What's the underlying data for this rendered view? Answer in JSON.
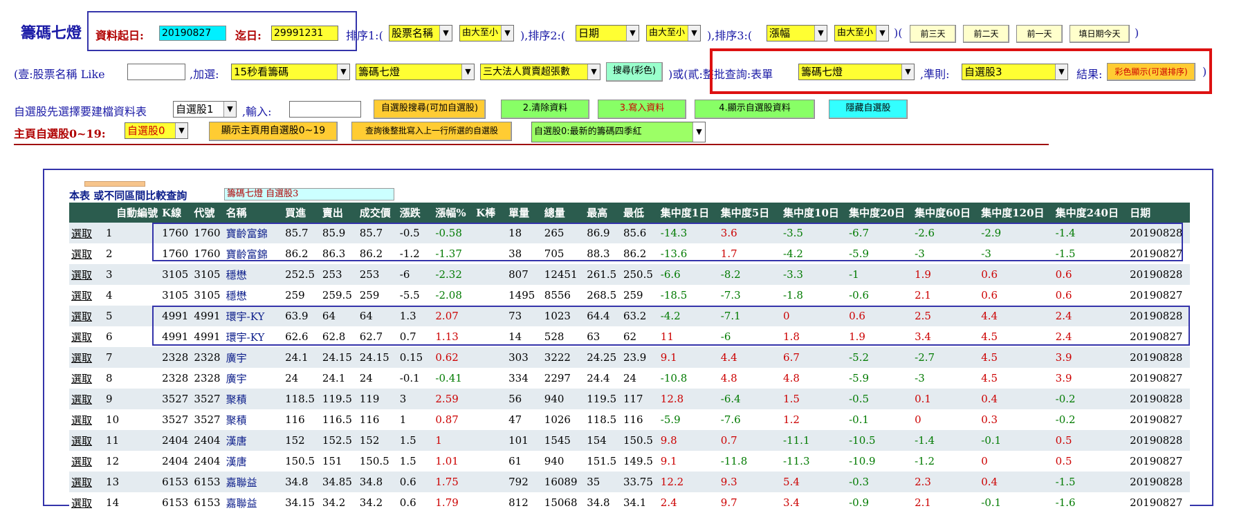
{
  "header": {
    "title": "籌碼七燈",
    "start_label": "資料起日:",
    "start_value": "20190827",
    "end_label": "迄日:",
    "end_value": "29991231",
    "sort1_label": "排序1:(",
    "sort1_field": "股票名稱",
    "sort1_order": "由大至小",
    "sort2_label": "),排序2:(",
    "sort2_field": "日期",
    "sort2_order": "由大至小",
    "sort3_label": "),排序3:(",
    "sort3_field": "漲幅",
    "sort3_order": "由大至小",
    "sort3_close": ")(",
    "btn_3days": "前三天",
    "btn_2days": "前二天",
    "btn_1day": "前一天",
    "btn_today": "填日期今天",
    "paren_close": ")"
  },
  "row2": {
    "like_label": "(壹:股票名稱 Like",
    "like_value": "",
    "add_label": ",加選:",
    "add1": "15秒看籌碼",
    "add2": "籌碼七燈",
    "add3": "三大法人買賣超張數",
    "search_btn": "搜尋(彩色)",
    "or_label": ")或(貳:整批查詢:表單",
    "form_select": "籌碼七燈",
    "rule_label": ",準則:",
    "rule_select": "自選股3",
    "result_label": "結果:",
    "result_btn": "彩色顯示(可選排序)",
    "close": ")"
  },
  "row3": {
    "label": "自選股先選擇要建檔資料表",
    "table_select": "自選股1",
    "input_label": ",輸入:",
    "input_value": "",
    "btn_search": "自選股搜尋(可加自選股)",
    "btn_clear": "2.清除資料",
    "btn_write": "3.寫入資料",
    "btn_show": "4.顯示自選股資料",
    "btn_hide": "隱藏自選股"
  },
  "row4": {
    "label": "主頁自選股0~19:",
    "select": "自選股0",
    "btn_show": "顯示主頁用自選股0~19",
    "btn_batch": "查詢後整批寫入上一行所選的自選股",
    "info_select": "自選股0:最新的籌碼四季紅"
  },
  "table_section": {
    "caption": "本表 或不同區間比較查詢",
    "caption_box": "籌碼七燈 自選股3",
    "pick_label": "選取",
    "columns": [
      "自動編號",
      "K線",
      "代號",
      "名稱",
      "買進",
      "賣出",
      "成交價",
      "漲跌",
      "漲幅%",
      "K棒",
      "單量",
      "總量",
      "最高",
      "最低",
      "集中度1日",
      "集中度5日",
      "集中度10日",
      "集中度20日",
      "集中度60日",
      "集中度120日",
      "集中度240日",
      "日期"
    ],
    "rows": [
      [
        "1",
        "1760",
        "1760",
        "寶齡富錦",
        "85.7",
        "85.9",
        "85.7",
        "-0.5",
        "-0.58",
        "",
        "18",
        "265",
        "86.9",
        "85.6",
        "-14.3",
        "3.6",
        "-3.5",
        "-6.7",
        "-2.6",
        "-2.9",
        "-1.4",
        "20190828"
      ],
      [
        "2",
        "1760",
        "1760",
        "寶齡富錦",
        "86.2",
        "86.3",
        "86.2",
        "-1.2",
        "-1.37",
        "",
        "38",
        "705",
        "88.3",
        "86.2",
        "-13.6",
        "1.7",
        "-4.2",
        "-5.9",
        "-3",
        "-3",
        "-1.5",
        "20190827"
      ],
      [
        "3",
        "3105",
        "3105",
        "穩懋",
        "252.5",
        "253",
        "253",
        "-6",
        "-2.32",
        "",
        "807",
        "12451",
        "261.5",
        "250.5",
        "-6.6",
        "-8.2",
        "-3.3",
        "-1",
        "1.9",
        "0.6",
        "0.6",
        "20190828"
      ],
      [
        "4",
        "3105",
        "3105",
        "穩懋",
        "259",
        "259.5",
        "259",
        "-5.5",
        "-2.08",
        "",
        "1495",
        "8556",
        "268.5",
        "259",
        "-18.5",
        "-7.3",
        "-1.8",
        "-0.6",
        "2.1",
        "0.6",
        "0.6",
        "20190827"
      ],
      [
        "5",
        "4991",
        "4991",
        "環宇-KY",
        "63.9",
        "64",
        "64",
        "1.3",
        "2.07",
        "",
        "73",
        "1023",
        "64.4",
        "63.2",
        "-4.2",
        "-7.1",
        "0",
        "0.6",
        "2.5",
        "4.4",
        "2.4",
        "20190828"
      ],
      [
        "6",
        "4991",
        "4991",
        "環宇-KY",
        "62.6",
        "62.8",
        "62.7",
        "0.7",
        "1.13",
        "",
        "14",
        "528",
        "63",
        "62",
        "11",
        "-6",
        "1.8",
        "1.9",
        "3.4",
        "4.5",
        "2.4",
        "20190827"
      ],
      [
        "7",
        "2328",
        "2328",
        "廣宇",
        "24.1",
        "24.15",
        "24.15",
        "0.15",
        "0.62",
        "",
        "303",
        "3222",
        "24.25",
        "23.9",
        "9.1",
        "4.4",
        "6.7",
        "-5.2",
        "-2.7",
        "4.5",
        "3.9",
        "20190828"
      ],
      [
        "8",
        "2328",
        "2328",
        "廣宇",
        "24",
        "24.1",
        "24",
        "-0.1",
        "-0.41",
        "",
        "334",
        "2297",
        "24.4",
        "24",
        "-10.8",
        "4.8",
        "4.8",
        "-5.9",
        "-3",
        "4.5",
        "3.9",
        "20190827"
      ],
      [
        "9",
        "3527",
        "3527",
        "聚積",
        "118.5",
        "119.5",
        "119",
        "3",
        "2.59",
        "",
        "56",
        "940",
        "119.5",
        "117",
        "12.8",
        "-6.4",
        "1.5",
        "-0.5",
        "0.1",
        "0.4",
        "-0.2",
        "20190828"
      ],
      [
        "10",
        "3527",
        "3527",
        "聚積",
        "116",
        "116.5",
        "116",
        "1",
        "0.87",
        "",
        "47",
        "1026",
        "118.5",
        "116",
        "-5.9",
        "-7.6",
        "1.2",
        "-0.1",
        "0",
        "0.3",
        "-0.2",
        "20190827"
      ],
      [
        "11",
        "2404",
        "2404",
        "漢唐",
        "152",
        "152.5",
        "152",
        "1.5",
        "1",
        "",
        "101",
        "1545",
        "154",
        "150.5",
        "9.8",
        "0.7",
        "-11.1",
        "-10.5",
        "-1.4",
        "-0.1",
        "0.5",
        "20190828"
      ],
      [
        "12",
        "2404",
        "2404",
        "漢唐",
        "150.5",
        "151",
        "150.5",
        "1.5",
        "1.01",
        "",
        "61",
        "940",
        "151.5",
        "149.5",
        "9.1",
        "-11.8",
        "-11.3",
        "-10.9",
        "-1.2",
        "0",
        "0.5",
        "20190827"
      ],
      [
        "13",
        "6153",
        "6153",
        "嘉聯益",
        "34.8",
        "34.85",
        "34.8",
        "0.6",
        "1.75",
        "",
        "792",
        "16089",
        "35",
        "33.75",
        "12.2",
        "9.3",
        "5.4",
        "-0.3",
        "2.3",
        "0.4",
        "-1.5",
        "20190828"
      ],
      [
        "14",
        "6153",
        "6153",
        "嘉聯益",
        "34.15",
        "34.2",
        "34.2",
        "0.6",
        "1.79",
        "",
        "812",
        "15068",
        "34.8",
        "34.1",
        "2.4",
        "9.7",
        "3.4",
        "-0.9",
        "2.1",
        "-0.1",
        "-1.6",
        "20190827"
      ]
    ]
  },
  "colors": {
    "header_bg": "#2b5c4e",
    "row_alt": "#e4ebf0",
    "positive": "#cc0000",
    "negative": "#007a00",
    "frame_blue": "#3333aa",
    "frame_red": "#dd1111"
  }
}
